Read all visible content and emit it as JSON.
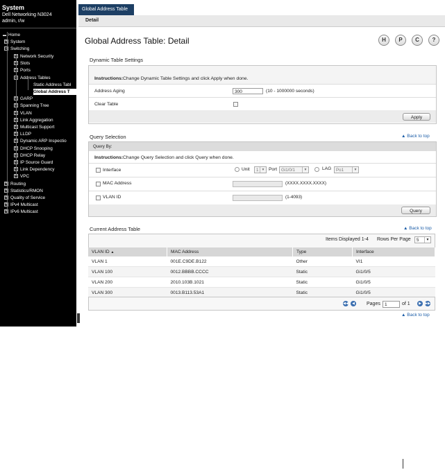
{
  "sidebar": {
    "title": "System",
    "model": "Dell Networking N3024",
    "user": "admin, r/w",
    "items": [
      {
        "label": "Home",
        "pm": ""
      },
      {
        "label": "System",
        "pm": "+"
      },
      {
        "label": "Switching",
        "pm": "-"
      },
      {
        "label": "Network Security",
        "pm": "+"
      },
      {
        "label": "Slots",
        "pm": "+"
      },
      {
        "label": "Ports",
        "pm": "+"
      },
      {
        "label": "Address Tables",
        "pm": "-"
      },
      {
        "label": "Static Address Tabl",
        "pm": ""
      },
      {
        "label": "Global Address T",
        "pm": ""
      },
      {
        "label": "GARP",
        "pm": "+"
      },
      {
        "label": "Spanning Tree",
        "pm": "+"
      },
      {
        "label": "VLAN",
        "pm": "+"
      },
      {
        "label": "Link Aggregation",
        "pm": "+"
      },
      {
        "label": "Multicast Support",
        "pm": "+"
      },
      {
        "label": "LLDP",
        "pm": "+"
      },
      {
        "label": "Dynamic ARP Inspectio",
        "pm": "+"
      },
      {
        "label": "DHCP Snooping",
        "pm": "+"
      },
      {
        "label": "DHCP Relay",
        "pm": "+"
      },
      {
        "label": "IP Source Guard",
        "pm": "+"
      },
      {
        "label": "Link Dependency",
        "pm": "+"
      },
      {
        "label": "VPC",
        "pm": "+"
      },
      {
        "label": "Routing",
        "pm": "+"
      },
      {
        "label": "Statistics/RMON",
        "pm": "+"
      },
      {
        "label": "Quality of Service",
        "pm": "+"
      },
      {
        "label": "IPv4 Multicast",
        "pm": "+"
      },
      {
        "label": "IPv6 Multicast",
        "pm": "+"
      }
    ]
  },
  "tabs": {
    "main": "Global Address Table",
    "sub": "Detail"
  },
  "page_title": "Global Address Table: Detail",
  "toolbar": {
    "save": "H",
    "print": "P",
    "refresh": "C",
    "help": "?"
  },
  "dynamic": {
    "title": "Dynamic Table Settings",
    "instructions_bold": "Instructions:",
    "instructions": "Change Dynamic Table Settings and click Apply when done.",
    "aging_label": "Address Aging",
    "aging_value": "300",
    "aging_hint": "(10 - 1000000 seconds)",
    "clear_label": "Clear Table",
    "apply": "Apply"
  },
  "query": {
    "title": "Query Selection",
    "back_to_top": "Back to top",
    "query_by": "Query By:",
    "instructions_bold": "Instructions:",
    "instructions": "Change Query Selection and click Query when done.",
    "interface_label": "Interface",
    "unit_label": "Unit",
    "unit_value": "1",
    "port_label": "Port",
    "port_value": "Gi1/0/1",
    "lag_label": "LAG",
    "lag_value": "Po1",
    "mac_label": "MAC Address",
    "mac_hint": "(XXXX.XXXX.XXXX)",
    "vlan_label": "VLAN ID",
    "vlan_hint": "(1-4093)",
    "query_btn": "Query"
  },
  "current": {
    "title": "Current Address Table",
    "back_to_top": "Back to top",
    "items_displayed": "Items Displayed 1-4",
    "rows_per_page_label": "Rows Per Page",
    "rows_per_page": "5",
    "columns": [
      "VLAN ID",
      "MAC Address",
      "Type",
      "Interface"
    ],
    "sort_indicator": "▲",
    "rows": [
      [
        "VLAN 1",
        "001E.C9DE.B122",
        "Other",
        "VI1"
      ],
      [
        "VLAN 100",
        "0012.BBBB.CCCC",
        "Static",
        "Gi1/0/5"
      ],
      [
        "VLAN 200",
        "2010.103B.1021",
        "Static",
        "Gi1/0/5"
      ],
      [
        "VLAN 300",
        "0013.B113.53A1",
        "Static",
        "Gi1/0/5"
      ]
    ],
    "pages_label": "Pages",
    "page_value": "1",
    "of_label": "of 1"
  },
  "bottom_back_to_top": "Back to top"
}
